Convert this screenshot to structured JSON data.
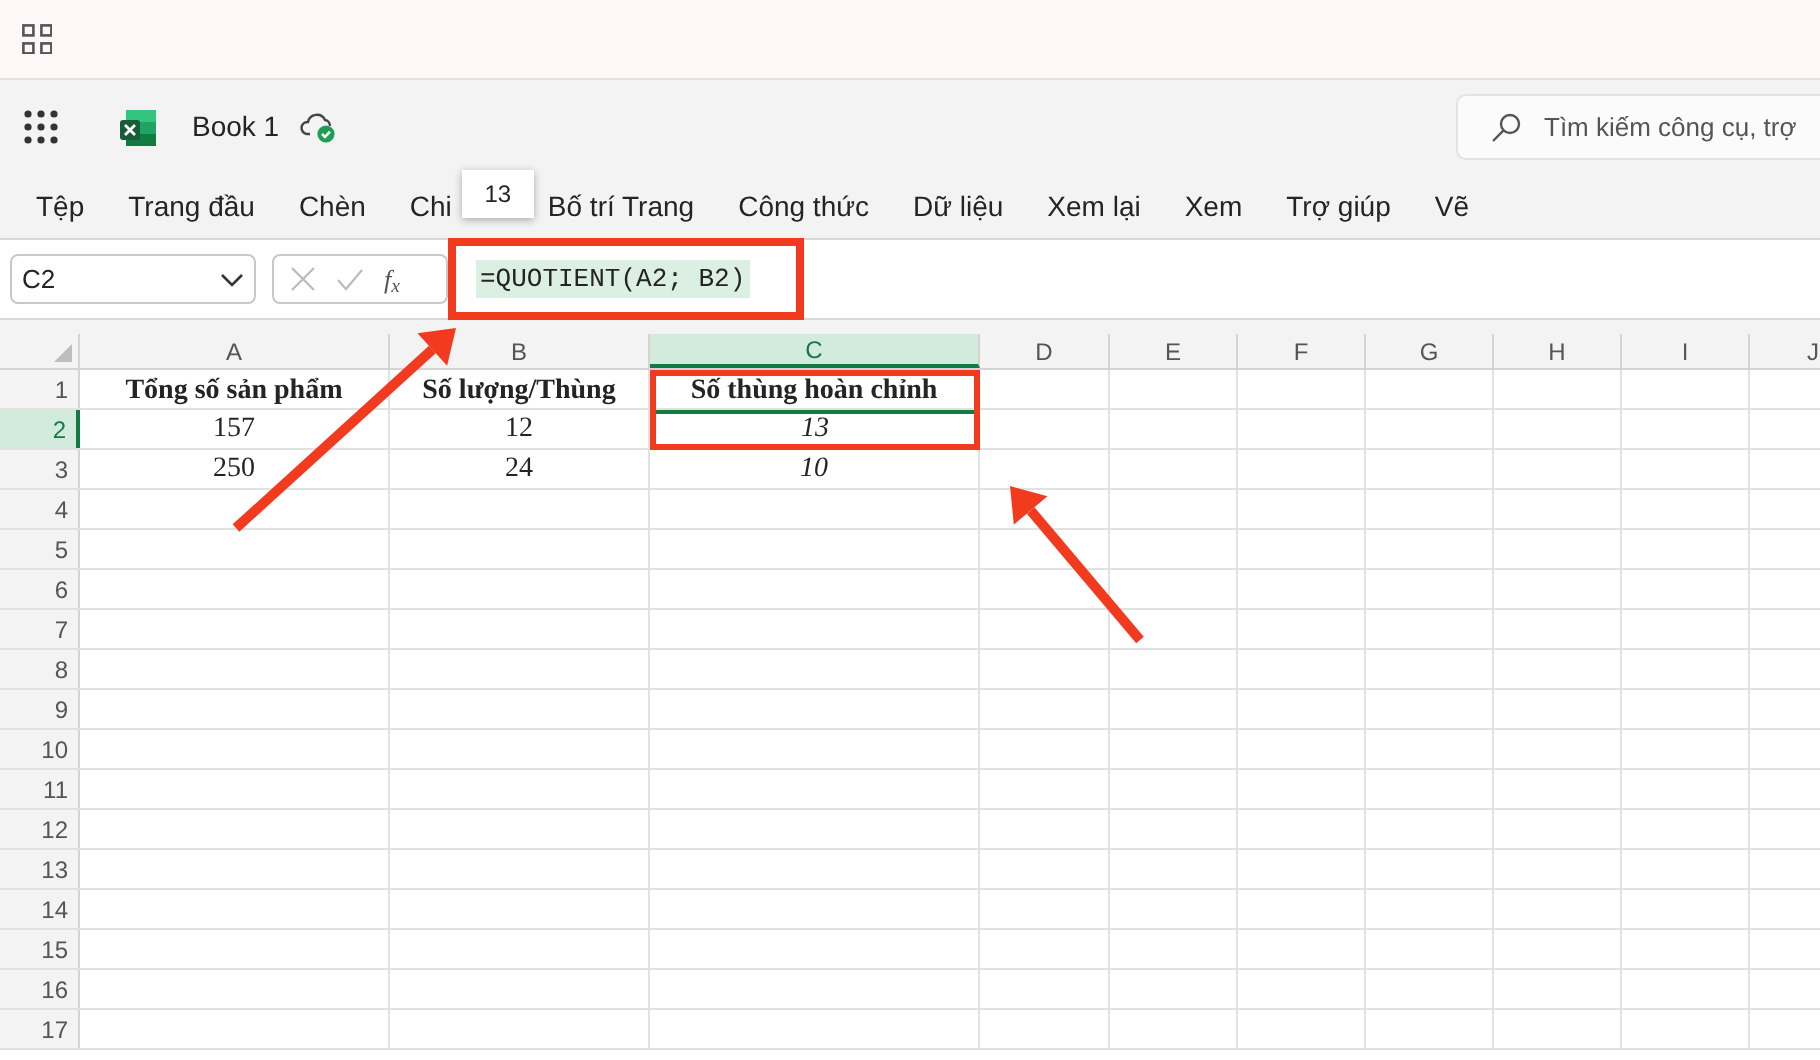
{
  "document": {
    "title": "Book 1"
  },
  "search": {
    "placeholder": "Tìm kiếm công cụ, trợ"
  },
  "menu": [
    {
      "label": "Tệp"
    },
    {
      "label": "Trang đầu"
    },
    {
      "label": "Chèn"
    },
    {
      "label": "Chi"
    },
    {
      "label": "Bố trí Trang"
    },
    {
      "label": "Công thức"
    },
    {
      "label": "Dữ liệu"
    },
    {
      "label": "Xem lại"
    },
    {
      "label": "Xem"
    },
    {
      "label": "Trợ giúp"
    },
    {
      "label": "Vẽ"
    }
  ],
  "tooltip": "13",
  "name_box": "C2",
  "function_label": "f$_{x}$",
  "formula": "=QUOTIENT(A2; B2)",
  "columns": [
    {
      "label": "A",
      "selected": false
    },
    {
      "label": "B",
      "selected": false
    },
    {
      "label": "C",
      "selected": true
    },
    {
      "label": "D",
      "selected": false
    },
    {
      "label": "E",
      "selected": false
    },
    {
      "label": "F",
      "selected": false
    },
    {
      "label": "G",
      "selected": false
    },
    {
      "label": "H",
      "selected": false
    },
    {
      "label": "I",
      "selected": false
    },
    {
      "label": "J",
      "selected": false
    }
  ],
  "rows": [
    {
      "label": "1",
      "selected": false,
      "cells": [
        {
          "text": "Tổng số sản phẩm",
          "bold": true,
          "italic": false,
          "selected": false
        },
        {
          "text": "Số lượng/Thùng",
          "bold": true,
          "italic": false,
          "selected": false
        },
        {
          "text": "Số thùng hoàn chỉnh",
          "bold": true,
          "italic": false,
          "selected": false
        }
      ]
    },
    {
      "label": "2",
      "selected": true,
      "cells": [
        {
          "text": "157",
          "bold": false,
          "italic": false,
          "selected": false
        },
        {
          "text": "12",
          "bold": false,
          "italic": false,
          "selected": false
        },
        {
          "text": "13",
          "bold": false,
          "italic": true,
          "selected": true
        }
      ]
    },
    {
      "label": "3",
      "selected": false,
      "cells": [
        {
          "text": "250",
          "bold": false,
          "italic": false,
          "selected": false
        },
        {
          "text": "24",
          "bold": false,
          "italic": false,
          "selected": false
        },
        {
          "text": "10",
          "bold": false,
          "italic": true,
          "selected": false
        }
      ]
    },
    {
      "label": "4",
      "selected": false
    },
    {
      "label": "5",
      "selected": false
    },
    {
      "label": "6",
      "selected": false
    },
    {
      "label": "7",
      "selected": false
    },
    {
      "label": "8",
      "selected": false
    },
    {
      "label": "9",
      "selected": false
    },
    {
      "label": "10",
      "selected": false
    },
    {
      "label": "11",
      "selected": false
    },
    {
      "label": "12",
      "selected": false
    },
    {
      "label": "13",
      "selected": false
    },
    {
      "label": "14",
      "selected": false
    },
    {
      "label": "15",
      "selected": false
    },
    {
      "label": "16",
      "selected": false
    },
    {
      "label": "17",
      "selected": false
    }
  ]
}
